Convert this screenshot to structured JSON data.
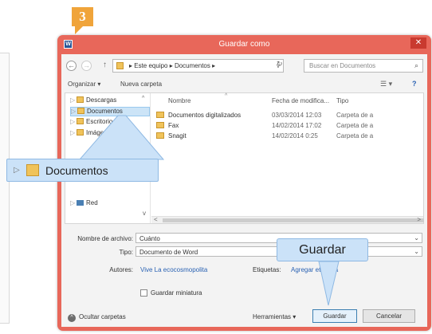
{
  "step_number": "3",
  "window": {
    "title": "Guardar como",
    "close_symbol": "✕",
    "app_icon_letter": "W"
  },
  "address": {
    "back_symbol": "←",
    "forward_symbol": "→",
    "up_symbol": "↑",
    "path_text": "▸ Este equipo ▸ Documentos ▸",
    "chevron": "v",
    "refresh_symbol": "↻",
    "search_placeholder": "Buscar en Documentos",
    "search_symbol": "⌕"
  },
  "toolbar": {
    "organize": "Organizar ▾",
    "new_folder": "Nueva carpeta",
    "view_symbol": "☰ ▾",
    "help_symbol": "?"
  },
  "nav_pane": {
    "items": [
      {
        "label": "Descargas"
      },
      {
        "label": "Documentos"
      },
      {
        "label": "Escritorio"
      },
      {
        "label": "Imágenes"
      }
    ],
    "network_label": "Red"
  },
  "file_list": {
    "columns": {
      "name": "Nombre",
      "date": "Fecha de modifica...",
      "type": "Tipo"
    },
    "rows": [
      {
        "name": "Documentos digitalizados",
        "date": "03/03/2014 12:03",
        "type": "Carpeta de a"
      },
      {
        "name": "Fax",
        "date": "14/02/2014 17:02",
        "type": "Carpeta de a"
      },
      {
        "name": "Snagit",
        "date": "14/02/2014 0:25",
        "type": "Carpeta de a"
      }
    ]
  },
  "form": {
    "filename_label": "Nombre de archivo:",
    "filename_value": "Cuánto",
    "type_label": "Tipo:",
    "type_value": "Documento de Word",
    "authors_label": "Autores:",
    "authors_value": "Vive La ecocosmopolita",
    "tags_label": "Etiquetas:",
    "tags_value": "Agregar etiqueta",
    "thumbnail_label": "Guardar miniatura"
  },
  "buttons": {
    "hide_folders": "Ocultar carpetas",
    "tools": "Herramientas ▾",
    "save": "Guardar",
    "cancel": "Cancelar"
  },
  "callouts": {
    "documents": "Documentos",
    "save": "Guardar"
  },
  "colors": {
    "titlebar": "#e8675a",
    "badge": "#f0a43a",
    "callout": "#cbe2f8",
    "selection": "#cce4f7"
  }
}
